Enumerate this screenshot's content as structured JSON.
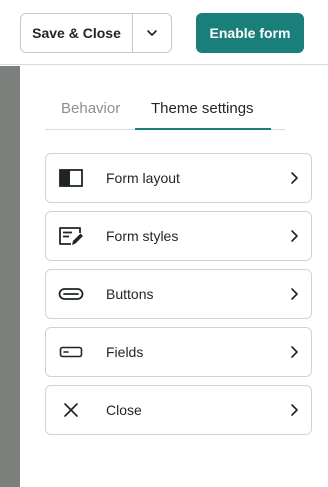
{
  "toolbar": {
    "save_close_label": "Save & Close",
    "save_options_icon": "chevron-down-icon",
    "enable_label": "Enable form"
  },
  "tabs": [
    {
      "label": "Behavior",
      "active": false
    },
    {
      "label": "Theme settings",
      "active": true
    }
  ],
  "theme_items": [
    {
      "label": "Form layout",
      "icon": "form-layout-icon"
    },
    {
      "label": "Form styles",
      "icon": "form-styles-icon"
    },
    {
      "label": "Buttons",
      "icon": "button-shape-icon"
    },
    {
      "label": "Fields",
      "icon": "field-shape-icon"
    },
    {
      "label": "Close",
      "icon": "close-icon"
    }
  ],
  "colors": {
    "accent": "#1a7f7a",
    "backdrop": "#7c807d",
    "text": "#1f2427",
    "muted_text": "#8b9093",
    "border": "#cfd3d5"
  }
}
